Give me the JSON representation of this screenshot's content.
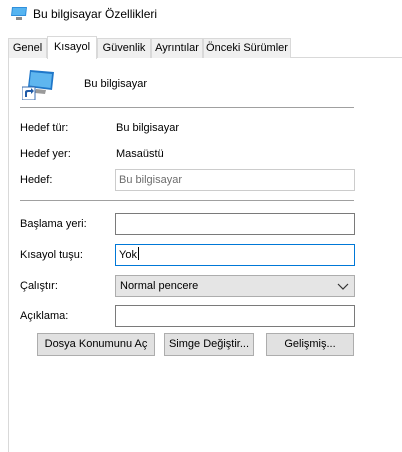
{
  "window": {
    "title": "Bu bilgisayar Özellikleri",
    "icon": "computer-shortcut-icon"
  },
  "tabs": [
    {
      "label": "Genel",
      "active": false
    },
    {
      "label": "Kısayol",
      "active": true
    },
    {
      "label": "Güvenlik",
      "active": false
    },
    {
      "label": "Ayrıntılar",
      "active": false
    },
    {
      "label": "Önceki Sürümler",
      "active": false
    }
  ],
  "shortcut": {
    "name": "Bu bilgisayar",
    "icon": "computer-icon"
  },
  "fields": {
    "target_type": {
      "label": "Hedef tür:",
      "value": "Bu bilgisayar"
    },
    "target_location": {
      "label": "Hedef yer:",
      "value": "Masaüstü"
    },
    "target": {
      "label": "Hedef:",
      "value": "Bu bilgisayar"
    },
    "start_in": {
      "label": "Başlama yeri:",
      "value": ""
    },
    "shortcut_key": {
      "label": "Kısayol tuşu:",
      "value": "Yok"
    },
    "run": {
      "label": "Çalıştır:",
      "value": "Normal pencere"
    },
    "comment": {
      "label": "Açıklama:",
      "value": ""
    }
  },
  "buttons": {
    "open_location": "Dosya Konumunu Aç",
    "change_icon": "Simge Değiştir...",
    "advanced": "Gelişmiş..."
  },
  "colors": {
    "accent": "#0078d7",
    "disabled_text": "#6d6d6d",
    "button_bg": "#e1e1e1"
  }
}
